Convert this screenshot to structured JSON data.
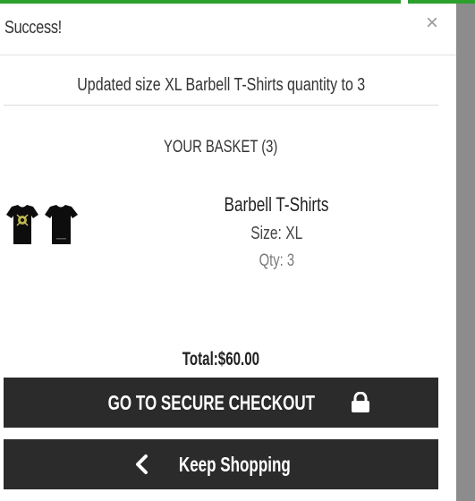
{
  "modal": {
    "title": "Success!",
    "close_glyph": "×",
    "message": "Updated size XL Barbell T-Shirts quantity to 3"
  },
  "basket": {
    "heading": "YOUR BASKET (3)",
    "item": {
      "name": "Barbell T-Shirts",
      "size": "Size: XL",
      "qty": "Qty: 3",
      "image_icon": "tshirt-thumbnail"
    },
    "total": "Total:$60.00"
  },
  "buttons": {
    "checkout_label": "GO TO SECURE CHECKOUT",
    "checkout_icon": "lock-icon",
    "shop_label": "Keep Shopping",
    "shop_icon": "chevron-left-icon"
  },
  "colors": {
    "accent_top_bar": "#2ca02c",
    "button_bg": "#2b2b2b",
    "button_text": "#ffffff",
    "qty_text": "#7a7a7a"
  }
}
